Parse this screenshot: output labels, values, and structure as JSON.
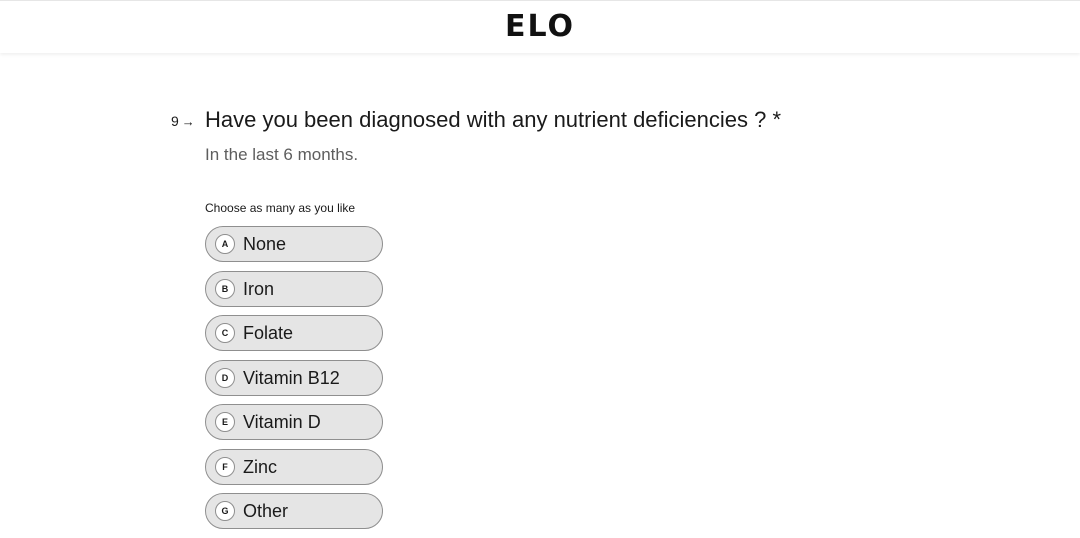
{
  "header": {
    "logo": "ELO"
  },
  "question": {
    "number": "9",
    "arrow": "→",
    "title": "Have you been diagnosed with any nutrient deficiencies ? *",
    "subtitle": "In the last 6 months.",
    "hint": "Choose as many as you like"
  },
  "options": [
    {
      "key": "A",
      "label": "None"
    },
    {
      "key": "B",
      "label": "Iron"
    },
    {
      "key": "C",
      "label": "Folate"
    },
    {
      "key": "D",
      "label": "Vitamin B12"
    },
    {
      "key": "E",
      "label": "Vitamin D"
    },
    {
      "key": "F",
      "label": "Zinc"
    },
    {
      "key": "G",
      "label": "Other"
    }
  ]
}
